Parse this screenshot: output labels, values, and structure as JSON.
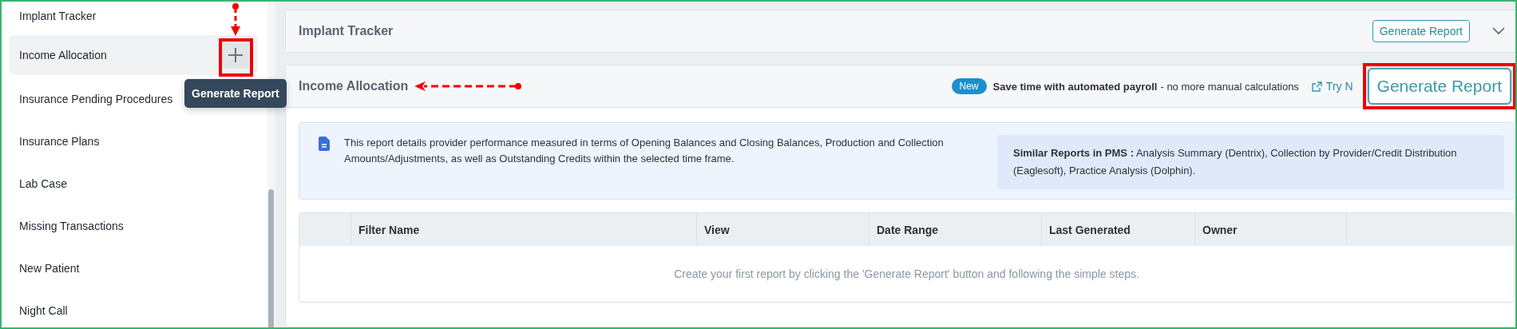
{
  "sidebar": {
    "items": [
      {
        "label": "Implant Tracker",
        "selected": false
      },
      {
        "label": "Income Allocation",
        "selected": true
      },
      {
        "label": "Insurance Pending Procedures",
        "selected": false
      },
      {
        "label": "Insurance Plans",
        "selected": false
      },
      {
        "label": "Lab Case",
        "selected": false
      },
      {
        "label": "Missing Transactions",
        "selected": false
      },
      {
        "label": "New Patient",
        "selected": false
      },
      {
        "label": "Night Call",
        "selected": false
      }
    ],
    "tooltip": "Generate Report"
  },
  "collapsed_card": {
    "title": "Implant Tracker",
    "button": "Generate Report"
  },
  "report_card": {
    "title": "Income Allocation",
    "badge": "New",
    "promo_bold": "Save time with automated payroll",
    "promo_rest": "- no more manual calculations",
    "link": "Try N",
    "button": "Generate Report",
    "description": "This report details provider performance measured in terms of Opening Balances and Closing Balances, Production and Collection Amounts/Adjustments, as well as Outstanding Credits within the selected time frame.",
    "similar": "**Similar Reports in PMS :** Analysis Summary (Dentrix), Collection by Provider/Credit Distribution (Eaglesoft), Practice Analysis (Dolphin).",
    "table": {
      "columns": [
        "Filter Name",
        "View",
        "Date Range",
        "Last Generated",
        "Owner"
      ],
      "empty_message": "Create your first report by clicking the 'Generate Report' button and following the simple steps."
    }
  }
}
